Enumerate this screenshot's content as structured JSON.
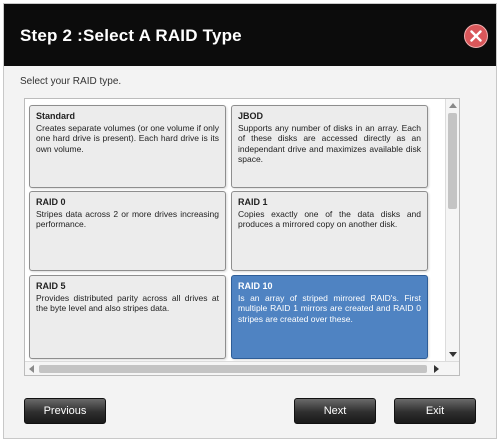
{
  "window": {
    "title": "Step 2 :Select A RAID Type",
    "instruction": "Select your RAID type."
  },
  "raid_options": [
    {
      "title": "Standard",
      "description": "Creates separate volumes (or one volume if only one hard drive is present). Each hard drive is its own volume.",
      "selected": false
    },
    {
      "title": "JBOD",
      "description": "Supports any number of disks in an array. Each of these disks are accessed directly as an independant drive and maximizes available disk space.",
      "selected": false
    },
    {
      "title": "RAID 0",
      "description": "Stripes data across 2 or more drives increasing performance.",
      "selected": false
    },
    {
      "title": "RAID 1",
      "description": "Copies exactly one of the data disks and produces a mirrored copy on another disk.",
      "selected": false
    },
    {
      "title": "RAID 5",
      "description": "Provides distributed parity across all drives at the byte level and also stripes data.",
      "selected": false
    },
    {
      "title": "RAID 10",
      "description": "Is an array of striped mirrored RAID's. First multiple RAID 1 mirrors are created and RAID 0 stripes are created over these.",
      "selected": true
    }
  ],
  "buttons": {
    "previous": "Previous",
    "next": "Next",
    "exit": "Exit"
  },
  "colors": {
    "title_bar": "#0c0c0c",
    "selected_card": "#4f83c2",
    "close_button": "#d9575a"
  }
}
